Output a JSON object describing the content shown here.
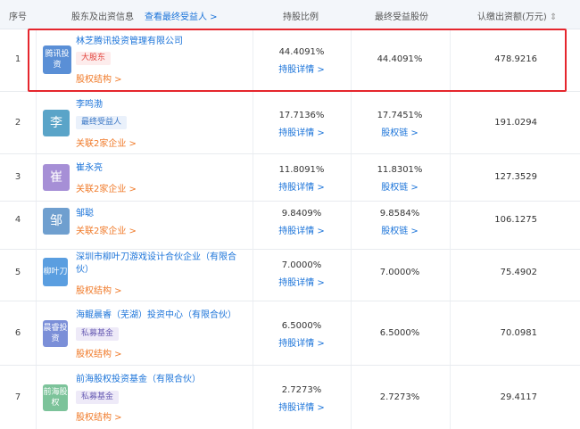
{
  "header": {
    "col_index": "序号",
    "col_holder": "股东及出资信息",
    "col_holder_link": "查看最终受益人 >",
    "col_ratio": "持股比例",
    "col_final": "最终受益股份",
    "col_amount": "认缴出资额(万元)",
    "sort_icon": "sort-updown-icon"
  },
  "rows": [
    {
      "index": "1",
      "logo": "腾讯投资",
      "logo_color": "#5a8fd6",
      "name": "林芝腾讯投资管理有限公司",
      "tag": "大股东",
      "link": "股权结构 >",
      "ratio": "44.4091%",
      "ratio_link": "持股详情 >",
      "final": "44.4091%",
      "final_link": "",
      "amount": "478.9216"
    },
    {
      "index": "2",
      "logo": "李",
      "logo_color": "#5aa4c8",
      "name": "李鸣渤",
      "tag": "最终受益人",
      "link": "关联2家企业 >",
      "ratio": "17.7136%",
      "ratio_link": "持股详情 >",
      "final": "17.7451%",
      "final_link": "股权链 >",
      "amount": "191.0294"
    },
    {
      "index": "3",
      "logo": "崔",
      "logo_color": "#a68fd6",
      "name": "崔永亮",
      "tag": "",
      "link": "关联2家企业 >",
      "ratio": "11.8091%",
      "ratio_link": "持股详情 >",
      "final": "11.8301%",
      "final_link": "股权链 >",
      "amount": "127.3529"
    },
    {
      "index": "4",
      "logo": "邹",
      "logo_color": "#6f9fcf",
      "name": "邹聪",
      "tag": "",
      "link": "关联2家企业 >",
      "ratio": "9.8409%",
      "ratio_link": "持股详情 >",
      "final": "9.8584%",
      "final_link": "股权链 >",
      "amount": "106.1275"
    },
    {
      "index": "5",
      "logo": "柳叶刀",
      "logo_color": "#5a9ee0",
      "name": "深圳市柳叶刀游戏设计合伙企业（有限合伙）",
      "tag": "",
      "link": "股权结构 >",
      "ratio": "7.0000%",
      "ratio_link": "持股详情 >",
      "final": "7.0000%",
      "final_link": "",
      "amount": "75.4902"
    },
    {
      "index": "6",
      "logo": "晨睿投资",
      "logo_color": "#7b8fd8",
      "name": "海鲲晨睿（芜湖）投资中心（有限合伙）",
      "tag": "私募基金",
      "link": "股权结构 >",
      "ratio": "6.5000%",
      "ratio_link": "持股详情 >",
      "final": "6.5000%",
      "final_link": "",
      "amount": "70.0981"
    },
    {
      "index": "7",
      "logo": "前海股权",
      "logo_color": "#7cc39a",
      "name": "前海股权投资基金（有限合伙）",
      "tag": "私募基金",
      "link": "股权结构 >",
      "ratio": "2.7273%",
      "ratio_link": "持股详情 >",
      "final": "2.7273%",
      "final_link": "",
      "amount": "29.4117"
    }
  ]
}
